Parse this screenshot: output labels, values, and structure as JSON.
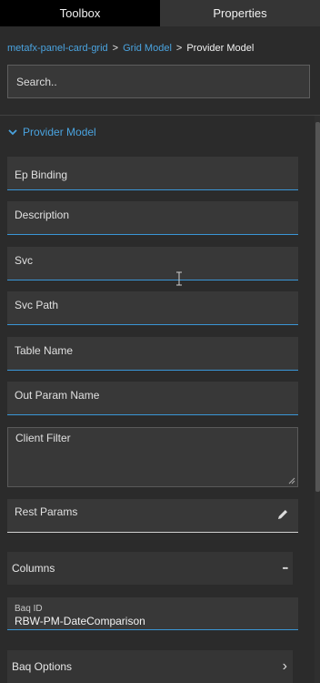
{
  "tabs": [
    {
      "label": "Toolbox",
      "active": true
    },
    {
      "label": "Properties",
      "active": false
    }
  ],
  "breadcrumb": {
    "items": [
      "metafx-panel-card-grid",
      "Grid Model"
    ],
    "separator": ">",
    "current": "Provider Model"
  },
  "search": {
    "placeholder": "Search.."
  },
  "section": {
    "title": "Provider Model",
    "expanded": true,
    "icon": "chevron-down-icon"
  },
  "fields": {
    "ep_binding": "Ep Binding",
    "description": "Description",
    "svc": "Svc",
    "svc_path": "Svc Path",
    "table_name": "Table Name",
    "out_param_name": "Out Param Name",
    "client_filter": "Client Filter",
    "rest_params": "Rest Params"
  },
  "columns": {
    "label": "Columns",
    "icon": "ellipsis-icon",
    "icon_text": "•••"
  },
  "baq_id": {
    "label": "Baq ID",
    "value": "RBW-PM-DateComparison"
  },
  "baq_options": {
    "label": "Baq Options",
    "icon": "chevron-right-icon",
    "icon_text": "›"
  },
  "colors": {
    "accent": "#4aa3df",
    "underline": "#3a96d6",
    "background": "#2b2b2b",
    "field": "#383838"
  }
}
